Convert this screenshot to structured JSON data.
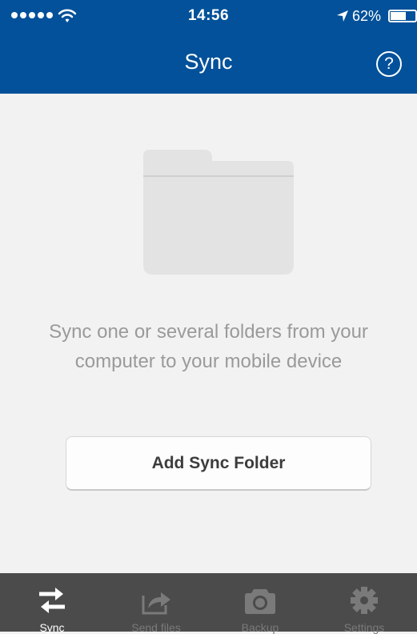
{
  "status_bar": {
    "time": "14:56",
    "battery_percent": "62%",
    "battery_level": 0.62,
    "signal_bars": 5
  },
  "header": {
    "title": "Sync",
    "help_label": "?"
  },
  "empty_state": {
    "icon": "folder-icon",
    "message": "Sync one or several folders from your computer to your mobile device",
    "button_label": "Add Sync Folder"
  },
  "tabs": [
    {
      "label": "Sync",
      "icon": "sync-arrows-icon",
      "active": true
    },
    {
      "label": "Send files",
      "icon": "share-icon",
      "active": false
    },
    {
      "label": "Backup",
      "icon": "camera-icon",
      "active": false
    },
    {
      "label": "Settings",
      "icon": "gear-icon",
      "active": false
    }
  ],
  "colors": {
    "header_bg": "#02519a",
    "content_bg": "#f2f2f2",
    "tab_bar_bg": "#4b4b4b",
    "tab_inactive": "#7a7a7a",
    "tab_active": "#ffffff"
  }
}
